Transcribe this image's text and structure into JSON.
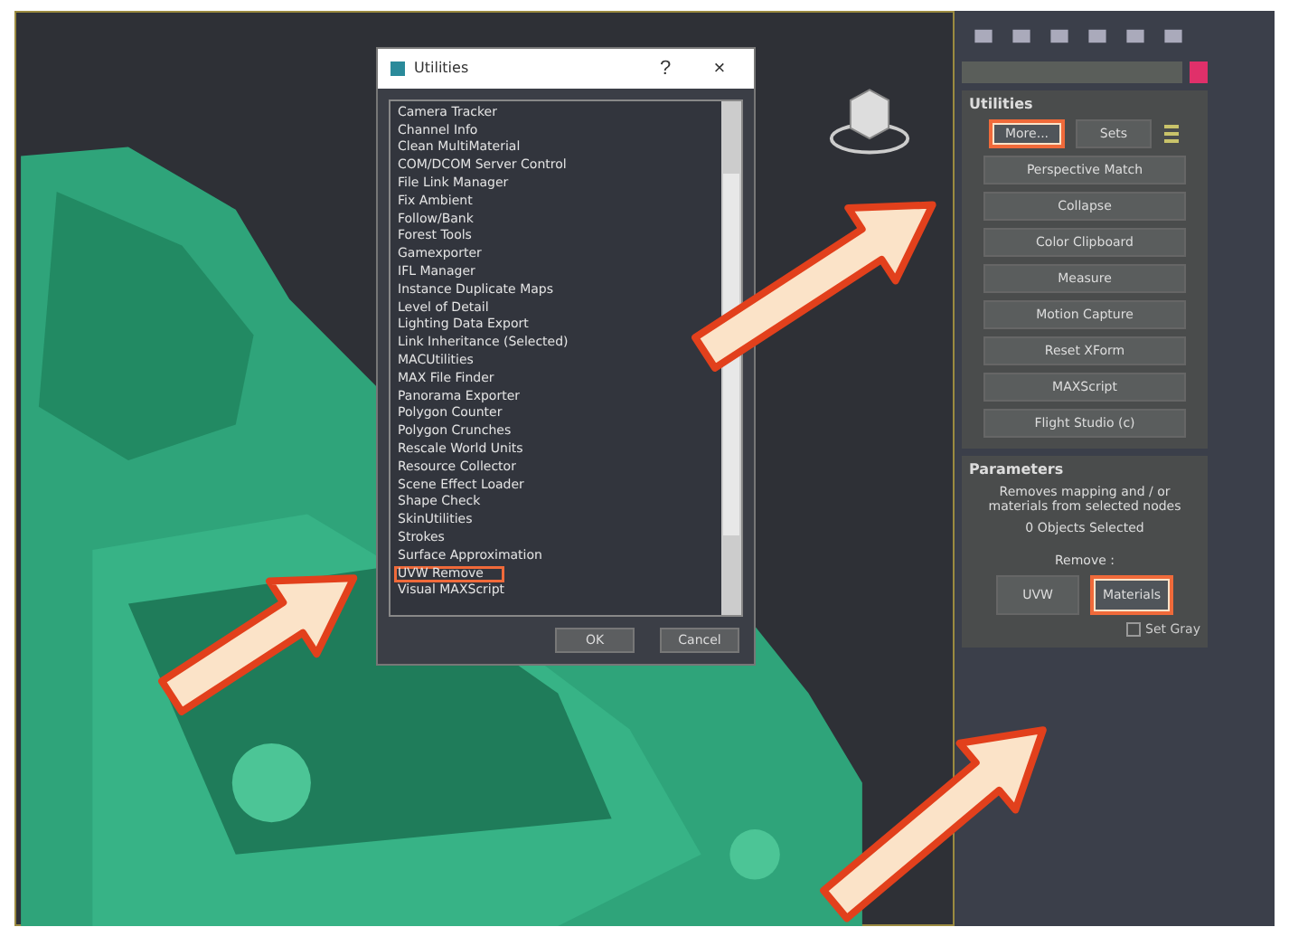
{
  "dialog": {
    "title": "Utilities",
    "help": "?",
    "close": "×",
    "items": [
      {
        "label": "Camera Tracker",
        "highlighted": false
      },
      {
        "label": "Channel Info",
        "highlighted": false
      },
      {
        "label": "Clean MultiMaterial",
        "highlighted": false
      },
      {
        "label": "COM/DCOM Server Control",
        "highlighted": false
      },
      {
        "label": "File Link Manager",
        "highlighted": false
      },
      {
        "label": "Fix Ambient",
        "highlighted": false
      },
      {
        "label": "Follow/Bank",
        "highlighted": false
      },
      {
        "label": "Forest Tools",
        "highlighted": false
      },
      {
        "label": "Gamexporter",
        "highlighted": false
      },
      {
        "label": "IFL Manager",
        "highlighted": false
      },
      {
        "label": "Instance Duplicate Maps",
        "highlighted": false
      },
      {
        "label": "Level of Detail",
        "highlighted": false
      },
      {
        "label": "Lighting Data Export",
        "highlighted": false
      },
      {
        "label": "Link Inheritance (Selected)",
        "highlighted": false
      },
      {
        "label": "MACUtilities",
        "highlighted": false
      },
      {
        "label": "MAX File Finder",
        "highlighted": false
      },
      {
        "label": "Panorama Exporter",
        "highlighted": false
      },
      {
        "label": "Polygon Counter",
        "highlighted": false
      },
      {
        "label": "Polygon Crunches",
        "highlighted": false
      },
      {
        "label": "Rescale World Units",
        "highlighted": false
      },
      {
        "label": "Resource Collector",
        "highlighted": false
      },
      {
        "label": "Scene Effect Loader",
        "highlighted": false
      },
      {
        "label": "Shape Check",
        "highlighted": false
      },
      {
        "label": "SkinUtilities",
        "highlighted": false
      },
      {
        "label": "Strokes",
        "highlighted": false
      },
      {
        "label": "Surface Approximation",
        "highlighted": false
      },
      {
        "label": "UVW Remove",
        "highlighted": true
      },
      {
        "label": "Visual MAXScript",
        "highlighted": false
      }
    ],
    "buttons": [
      "OK",
      "Cancel"
    ]
  },
  "panel": {
    "utilities": {
      "title": "Utilities",
      "top_buttons": [
        {
          "label": "More...",
          "highlighted": true
        },
        {
          "label": "Sets",
          "highlighted": false
        }
      ],
      "buttons": [
        "Perspective Match",
        "Collapse",
        "Color Clipboard",
        "Measure",
        "Motion Capture",
        "Reset XForm",
        "MAXScript",
        "Flight Studio (c)"
      ]
    },
    "parameters": {
      "title": "Parameters",
      "description": "Removes mapping and / or materials from selected nodes",
      "status": "0 Objects Selected",
      "remove_label": "Remove :",
      "buttons": [
        {
          "label": "UVW",
          "highlighted": false
        },
        {
          "label": "Materials",
          "highlighted": true
        }
      ],
      "checkbox": {
        "label": "Set Gray",
        "checked": false
      }
    }
  }
}
